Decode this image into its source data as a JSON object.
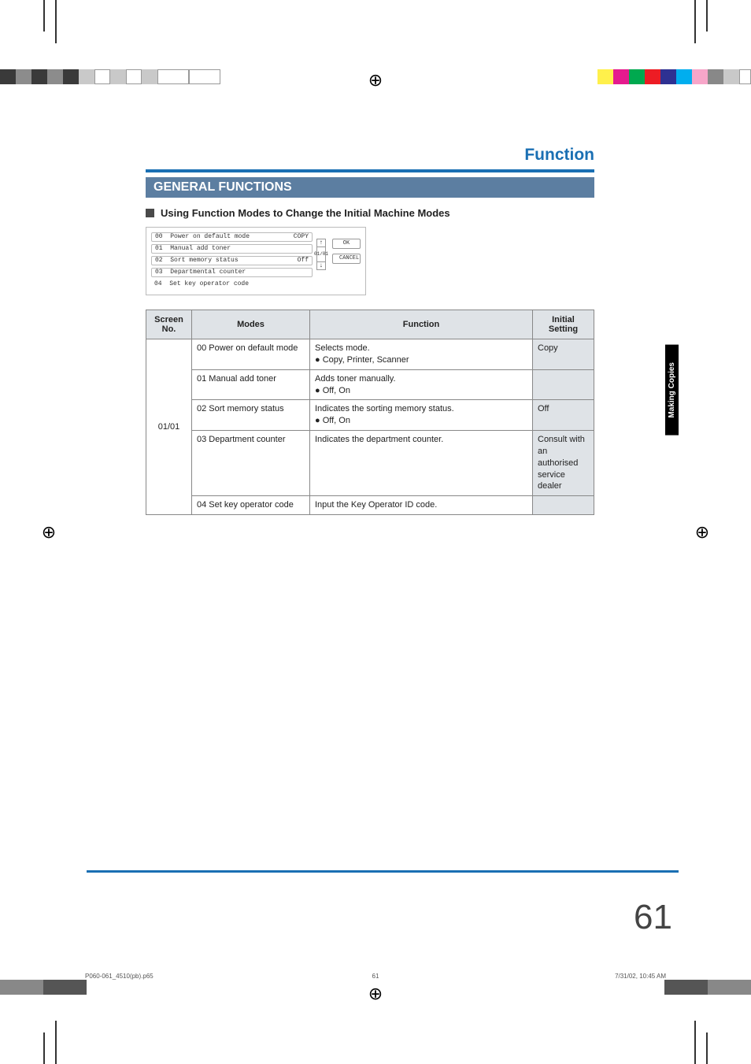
{
  "header": {
    "function_title": "Function",
    "ribbon": "GENERAL FUNCTIONS",
    "subheading": "Using Function Modes to Change the Initial Machine Modes"
  },
  "panel": {
    "rows": [
      {
        "num": "00",
        "label": "Power on default mode",
        "val": "COPY"
      },
      {
        "num": "01",
        "label": "Manual add toner",
        "val": ""
      },
      {
        "num": "02",
        "label": "Sort memory status",
        "val": "Off"
      },
      {
        "num": "03",
        "label": "Departmental counter",
        "val": ""
      },
      {
        "num": "04",
        "label": "Set key operator code",
        "val": ""
      }
    ],
    "scroll_label": "01/01",
    "ok": "OK",
    "cancel": "CANCEL",
    "up": "↑",
    "down": "↓"
  },
  "table": {
    "headers": {
      "screen": "Screen No.",
      "modes": "Modes",
      "function": "Function",
      "initial": "Initial Setting"
    },
    "screen_no": "01/01",
    "rows": [
      {
        "mode": "00 Power on default mode",
        "func_l1": "Selects mode.",
        "func_l2": "● Copy, Printer, Scanner",
        "setting": "Copy"
      },
      {
        "mode": "01 Manual add toner",
        "func_l1": "Adds toner manually.",
        "func_l2": "● Off, On",
        "setting": ""
      },
      {
        "mode": "02 Sort memory status",
        "func_l1": "Indicates the sorting memory status.",
        "func_l2": "● Off, On",
        "setting": "Off"
      },
      {
        "mode": "03 Department counter",
        "func_l1": "Indicates the department counter.",
        "func_l2": "",
        "setting": "Consult with an authorised service dealer"
      },
      {
        "mode": "04 Set key operator code",
        "func_l1": "Input the Key Operator ID code.",
        "func_l2": "",
        "setting": ""
      }
    ]
  },
  "side_tab": "Making Copies",
  "page_number": "61",
  "footer": {
    "left": "P060-061_4510(pb).p65",
    "center": "61",
    "right": "7/31/02, 10:45 AM"
  },
  "colors": {
    "top_left": [
      "#3a3a3a",
      "#8c8c8c",
      "#3a3a3a",
      "#8c8c8c",
      "#3a3a3a",
      "#c9c9c9",
      "#ffffff",
      "#c9c9c9",
      "#ffffff",
      "#c9c9c9"
    ],
    "top_right": [
      "#fff04b",
      "#e51b8e",
      "#00a94f",
      "#ed1c24",
      "#2e3192",
      "#00aeef",
      "#f7a6c9",
      "#888",
      "#c9c9c9"
    ],
    "bot_left": [
      "#888",
      "#555"
    ],
    "bot_right": [
      "#888",
      "#555"
    ]
  }
}
